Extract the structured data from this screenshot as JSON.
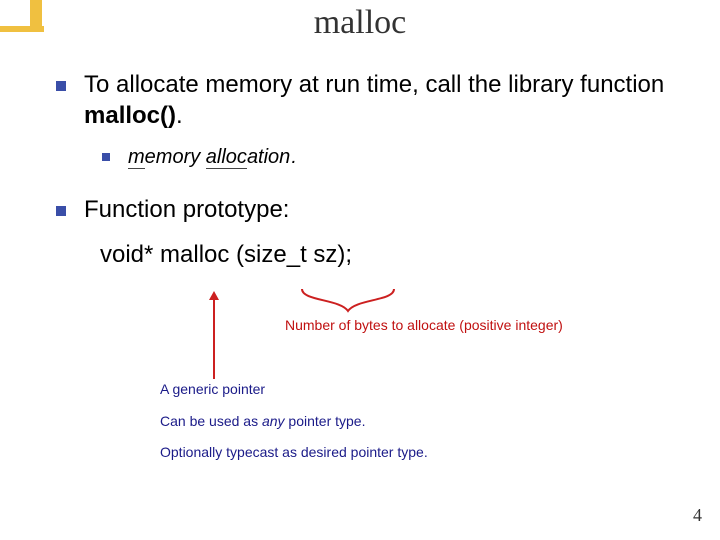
{
  "title": "malloc",
  "bullets": {
    "b1_pre": "To allocate memory at run time, call the library function ",
    "b1_bold": "malloc()",
    "b1_post": ".",
    "sub_prefix_m": "m",
    "sub_rest1": "emory ",
    "sub_alloc": "alloc",
    "sub_rest2": "ation",
    "sub_period": ".",
    "b2": "Function prototype:",
    "code": "void* malloc (size_t sz);"
  },
  "annotations": {
    "number_note": "Number of bytes to allocate (positive integer)",
    "n1": "A generic pointer",
    "n2_pre": "Can be used as ",
    "n2_em": "any",
    "n2_post": " pointer type.",
    "n3": "Optionally typecast as desired pointer type."
  },
  "page_number": "4"
}
